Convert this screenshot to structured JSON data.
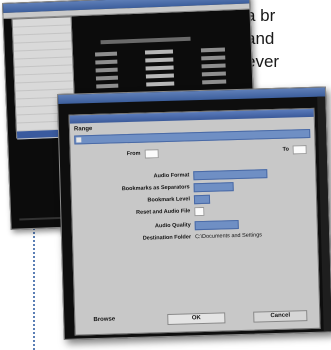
{
  "side_text": {
    "lines": [
      "a br",
      "and",
      "ever"
    ]
  },
  "background_window": {
    "menu_items": [
      "",
      "",
      "",
      "",
      "",
      "",
      "",
      "",
      "",
      "",
      "",
      "",
      "",
      "",
      ""
    ]
  },
  "dialog": {
    "range_label": "Range",
    "from_label": "From",
    "to_label": "To",
    "audio_format_label": "Audio Format",
    "audio_format_value": "",
    "bookmarks_label": "Bookmarks as Separators",
    "bookmarks_value": "",
    "bookmark_level_label": "Bookmark Level",
    "bookmark_level_value": "",
    "reset_label": "Reset and Audio File",
    "audio_quality_label": "Audio Quality",
    "audio_quality_value": "",
    "destination_label": "Destination Folder",
    "destination_value": "C:\\Documents and Settings",
    "buttons": {
      "browse": "Browse",
      "ok": "OK",
      "cancel": "Cancel"
    }
  },
  "colors": {
    "accent": "#6f8fc4",
    "dialog_bg": "#c8c8c8",
    "dotted_line": "#5b7fb5"
  }
}
